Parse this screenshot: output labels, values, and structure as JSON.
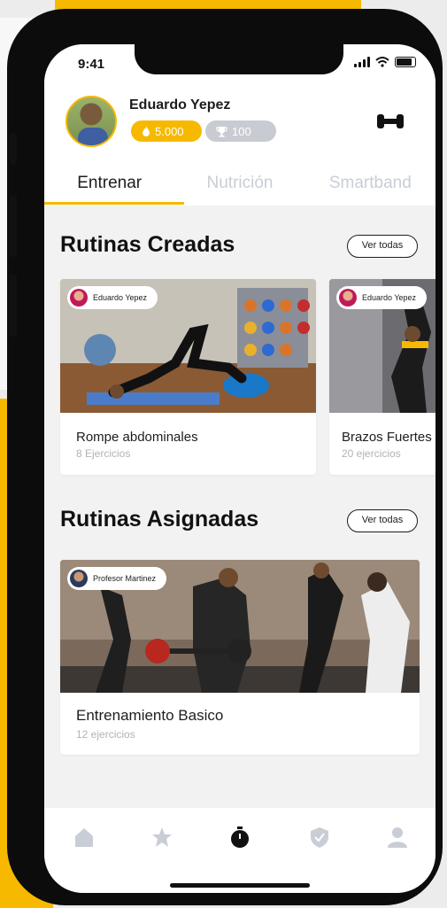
{
  "status_bar": {
    "time": "9:41"
  },
  "profile": {
    "name": "Eduardo Yepez",
    "points": "5.000",
    "trophies": "100"
  },
  "tabs": [
    {
      "label": "Entrenar",
      "active": true
    },
    {
      "label": "Nutrición",
      "active": false
    },
    {
      "label": "Smartband",
      "active": false
    }
  ],
  "sections": {
    "created": {
      "title": "Rutinas Creadas",
      "view_all": "Ver todas",
      "cards": [
        {
          "owner": "Eduardo Yepez",
          "title": "Rompe abdominales",
          "subtitle": "8 Ejercicios"
        },
        {
          "owner": "Eduardo Yepez",
          "title": "Brazos Fuertes",
          "subtitle": "20 ejercicios"
        }
      ]
    },
    "assigned": {
      "title": "Rutinas Asignadas",
      "view_all": "Ver todas",
      "cards": [
        {
          "owner": "Profesor Martinez",
          "title": "Entrenamiento Basico",
          "subtitle": "12 ejercicios"
        }
      ]
    }
  },
  "bottom_nav": [
    {
      "icon": "home-icon",
      "active": false
    },
    {
      "icon": "star-icon",
      "active": false
    },
    {
      "icon": "stopwatch-icon",
      "active": true
    },
    {
      "icon": "shield-icon",
      "active": false
    },
    {
      "icon": "profile-icon",
      "active": false
    }
  ],
  "colors": {
    "accent": "#f6b900",
    "inactive": "#c9cdd6",
    "text": "#1d1d1d"
  }
}
